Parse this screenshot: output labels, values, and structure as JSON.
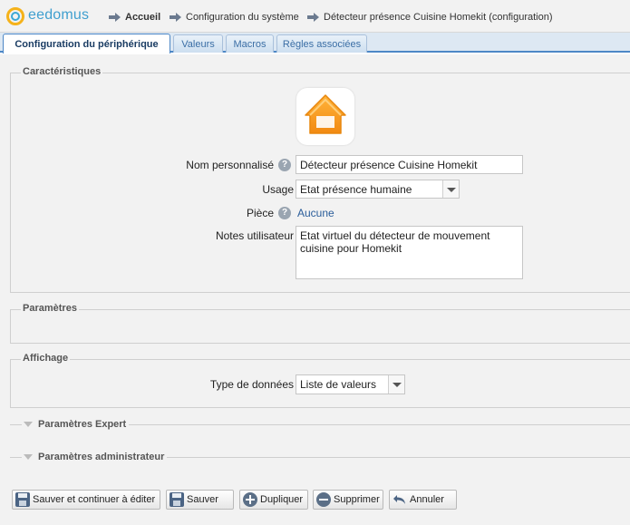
{
  "header": {
    "logo_text": "eedomus",
    "breadcrumbs": [
      {
        "label": "Accueil"
      },
      {
        "label": "Configuration du système"
      },
      {
        "label": "Détecteur présence Cuisine Homekit (configuration)"
      }
    ]
  },
  "tabs": [
    {
      "label": "Configuration du périphérique",
      "active": true
    },
    {
      "label": "Valeurs",
      "active": false
    },
    {
      "label": "Macros",
      "active": false
    },
    {
      "label": "Règles associées",
      "active": false
    }
  ],
  "characteristics": {
    "legend": "Caractéristiques",
    "icon": "home-icon",
    "name_label": "Nom personnalisé",
    "name_value": "Détecteur présence Cuisine Homekit",
    "usage_label": "Usage",
    "usage_value": "Etat présence humaine",
    "room_label": "Pièce",
    "room_value": "Aucune",
    "notes_label": "Notes utilisateur",
    "notes_value": "Etat virtuel du détecteur de mouvement cuisine pour Homekit"
  },
  "parameters": {
    "legend": "Paramètres"
  },
  "display": {
    "legend": "Affichage",
    "data_type_label": "Type de données",
    "data_type_value": "Liste de valeurs"
  },
  "expert": {
    "label": "Paramètres Expert"
  },
  "admin": {
    "label": "Paramètres administrateur"
  },
  "buttons": {
    "save_continue": "Sauver et continuer à éditer",
    "save": "Sauver",
    "duplicate": "Dupliquer",
    "delete": "Supprimer",
    "cancel": "Annuler"
  },
  "colors": {
    "accent": "#4d87c6",
    "home_icon": "#f5a623",
    "link": "#2a5d9a"
  }
}
